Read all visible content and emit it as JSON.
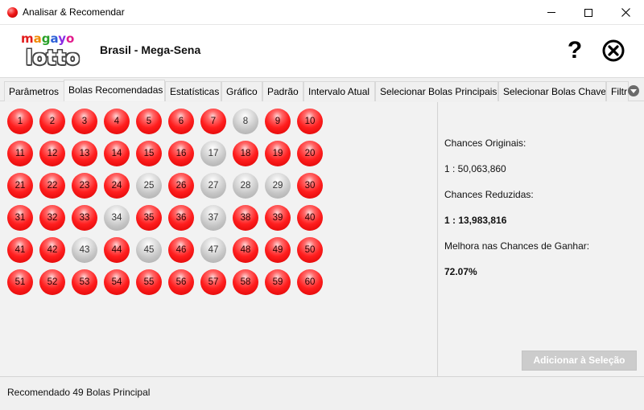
{
  "window": {
    "title": "Analisar & Recomendar"
  },
  "header": {
    "logo_top": "magayo",
    "logo_bottom": "lotto",
    "app_title": "Brasil - Mega-Sena",
    "help_symbol": "?"
  },
  "tabs": [
    {
      "label": "Parâmetros",
      "active": false
    },
    {
      "label": "Bolas Recomendadas",
      "active": true
    },
    {
      "label": "Estatísticas",
      "active": false
    },
    {
      "label": "Gráfico",
      "active": false
    },
    {
      "label": "Padrão",
      "active": false
    },
    {
      "label": "Intervalo Atual",
      "active": false
    },
    {
      "label": "Selecionar Bolas Principais",
      "active": false
    },
    {
      "label": "Selecionar Bolas Chave",
      "active": false
    },
    {
      "label": "Filtr",
      "active": false
    }
  ],
  "balls": {
    "numbers": [
      "1",
      "2",
      "3",
      "4",
      "5",
      "6",
      "7",
      "8",
      "9",
      "10",
      "11",
      "12",
      "13",
      "14",
      "15",
      "16",
      "17",
      "18",
      "19",
      "20",
      "21",
      "22",
      "23",
      "24",
      "25",
      "26",
      "27",
      "28",
      "29",
      "30",
      "31",
      "32",
      "33",
      "34",
      "35",
      "36",
      "37",
      "38",
      "39",
      "40",
      "41",
      "42",
      "43",
      "44",
      "45",
      "46",
      "47",
      "48",
      "49",
      "50",
      "51",
      "52",
      "53",
      "54",
      "55",
      "56",
      "57",
      "58",
      "59",
      "60"
    ],
    "not_recommended": [
      8,
      17,
      25,
      27,
      28,
      29,
      34,
      37,
      43,
      45,
      47
    ],
    "colors": {
      "recommended": "#ff1e1e",
      "not_recommended": "#c4c4c4"
    }
  },
  "info": {
    "original_label": "Chances Originais:",
    "original_value": "1 : 50,063,860",
    "reduced_label": "Chances Reduzidas:",
    "reduced_value": "1 : 13,983,816",
    "improvement_label": "Melhora nas Chances de Ganhar:",
    "improvement_value": "72.07%",
    "add_button": "Adicionar à Seleção"
  },
  "status": {
    "text": "Recomendado 49 Bolas Principal"
  }
}
